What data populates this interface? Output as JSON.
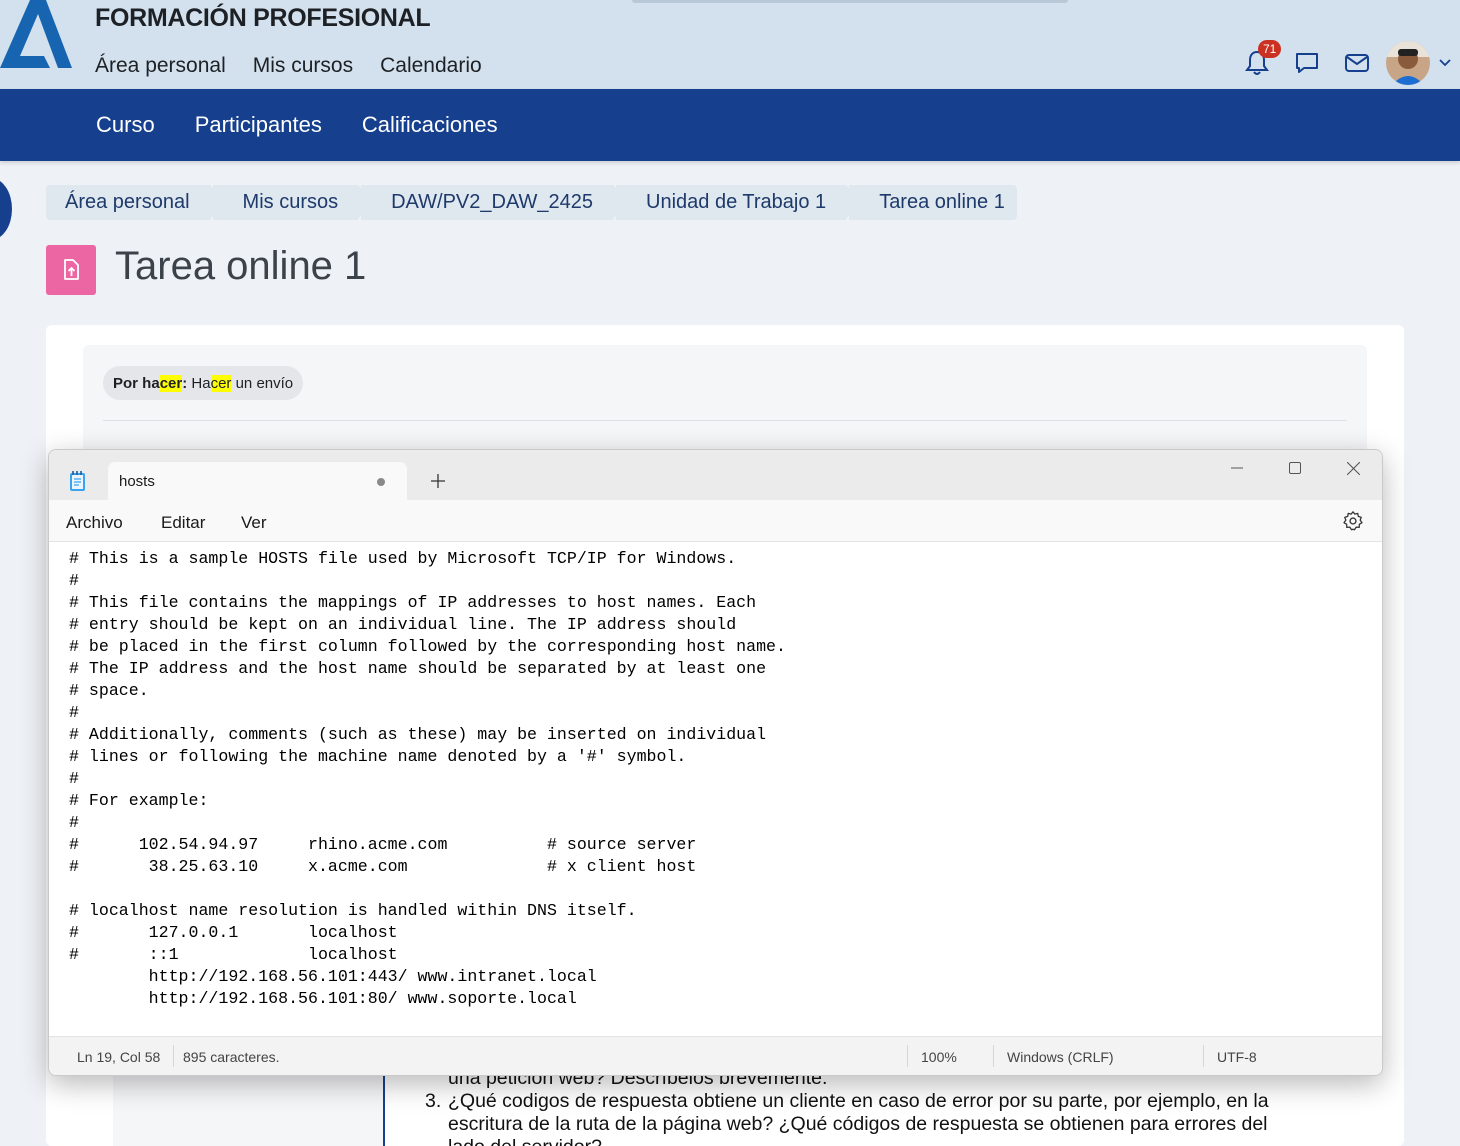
{
  "header": {
    "site_title": "FORMACIÓN PROFESIONAL",
    "nav": [
      "Área personal",
      "Mis cursos",
      "Calendario"
    ],
    "notifications_count": "71",
    "icons": [
      "bell-icon",
      "chat-icon",
      "mail-icon"
    ]
  },
  "course_nav": [
    "Curso",
    "Participantes",
    "Calificaciones"
  ],
  "breadcrumb": [
    "Área personal",
    "Mis cursos",
    "DAW/PV2_DAW_2425",
    "Unidad de Trabajo 1",
    "Tarea online 1"
  ],
  "page": {
    "title": "Tarea online 1",
    "status": {
      "prefix_label": "Por hacer",
      "text": "Hacer un envío"
    }
  },
  "background_list": {
    "partial_line": "una petición web? Descríbelos brevemente.",
    "item_number": "3.",
    "item_text": "¿Qué codigos de respuesta obtiene un cliente en caso de error por su parte, por ejemplo, en la escritura de la ruta de la página web? ¿Qué códigos de respuesta se obtienen para errores del lado del servidor?"
  },
  "notepad": {
    "tab_title": "hosts",
    "menu": [
      "Archivo",
      "Editar",
      "Ver"
    ],
    "lines": [
      "#",
      "# This is a sample HOSTS file used by Microsoft TCP/IP for Windows.",
      "#",
      "# This file contains the mappings of IP addresses to host names. Each",
      "# entry should be kept on an individual line. The IP address should",
      "# be placed in the first column followed by the corresponding host name.",
      "# The IP address and the host name should be separated by at least one",
      "# space.",
      "#",
      "# Additionally, comments (such as these) may be inserted on individual",
      "# lines or following the machine name denoted by a '#' symbol.",
      "#",
      "# For example:",
      "#",
      "#      102.54.94.97     rhino.acme.com          # source server",
      "#       38.25.63.10     x.acme.com              # x client host",
      "",
      "# localhost name resolution is handled within DNS itself.",
      "#       127.0.0.1       localhost",
      "#       ::1             localhost",
      "        http://192.168.56.101:443/ www.intranet.local",
      "        http://192.168.56.101:80/ www.soporte.local"
    ],
    "status": {
      "position": "Ln 19, Col 58",
      "chars": "895 caracteres.",
      "zoom": "100%",
      "line_ending": "Windows (CRLF)",
      "encoding": "UTF-8"
    }
  },
  "colors": {
    "brand_blue": "#16408e",
    "header_bg": "#d3e1ee",
    "assign_icon_pink": "#eb66a2",
    "highlight": "#ffff00"
  }
}
